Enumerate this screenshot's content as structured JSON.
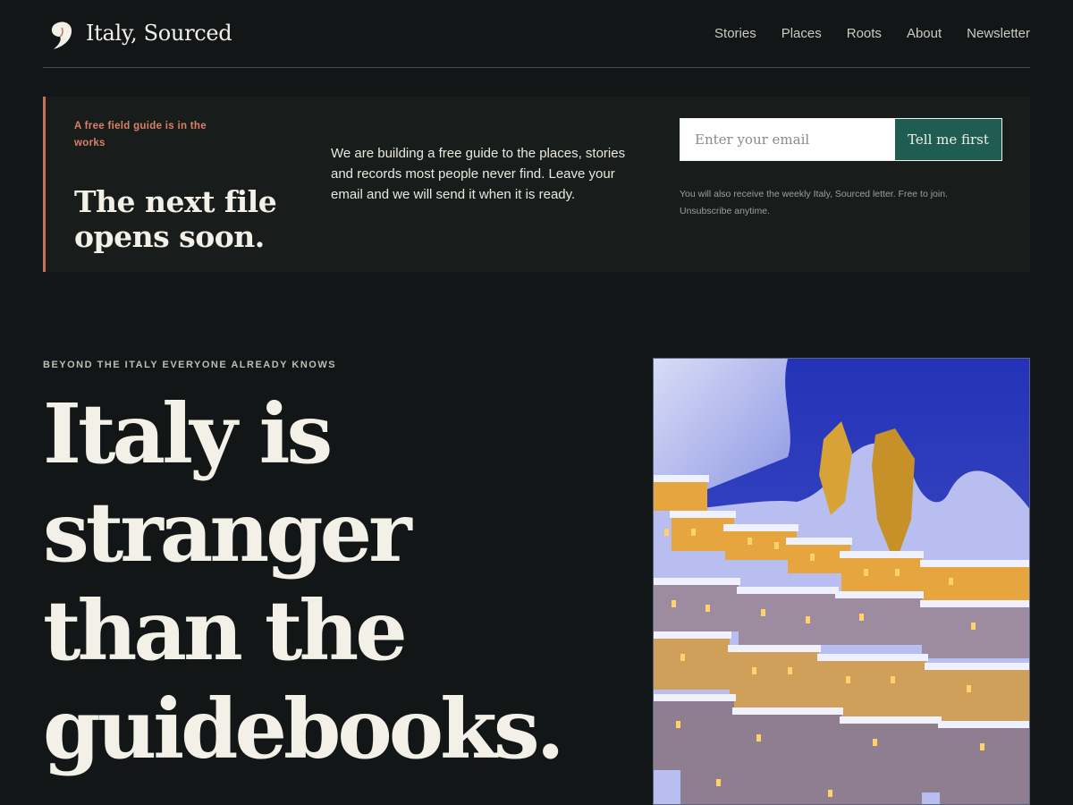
{
  "header": {
    "brand": "Italy, Sourced",
    "logo_icon": "comma-quote-icon",
    "nav": [
      {
        "label": "Stories"
      },
      {
        "label": "Places"
      },
      {
        "label": "Roots"
      },
      {
        "label": "About"
      },
      {
        "label": "Newsletter"
      }
    ]
  },
  "banner": {
    "eyebrow": "A free field guide is in the works",
    "title": "The next file opens soon.",
    "description": "We are building a free guide to the places, stories and records most people never find. Leave your email and we will send it when it is ready.",
    "email_placeholder": "Enter your email",
    "submit_label": "Tell me first",
    "fine_print": "You will also receive the weekly Italy, Sourced letter. Free to join. Unsubscribe anytime."
  },
  "hero": {
    "eyebrow": "BEYOND THE ITALY EVERYONE ALREADY KNOWS",
    "title": "Italy is stranger than the guidebooks."
  },
  "colors": {
    "background": "#121616",
    "accent": "#c96f5e",
    "button": "#1f5d52",
    "text": "#f3f0e8"
  }
}
